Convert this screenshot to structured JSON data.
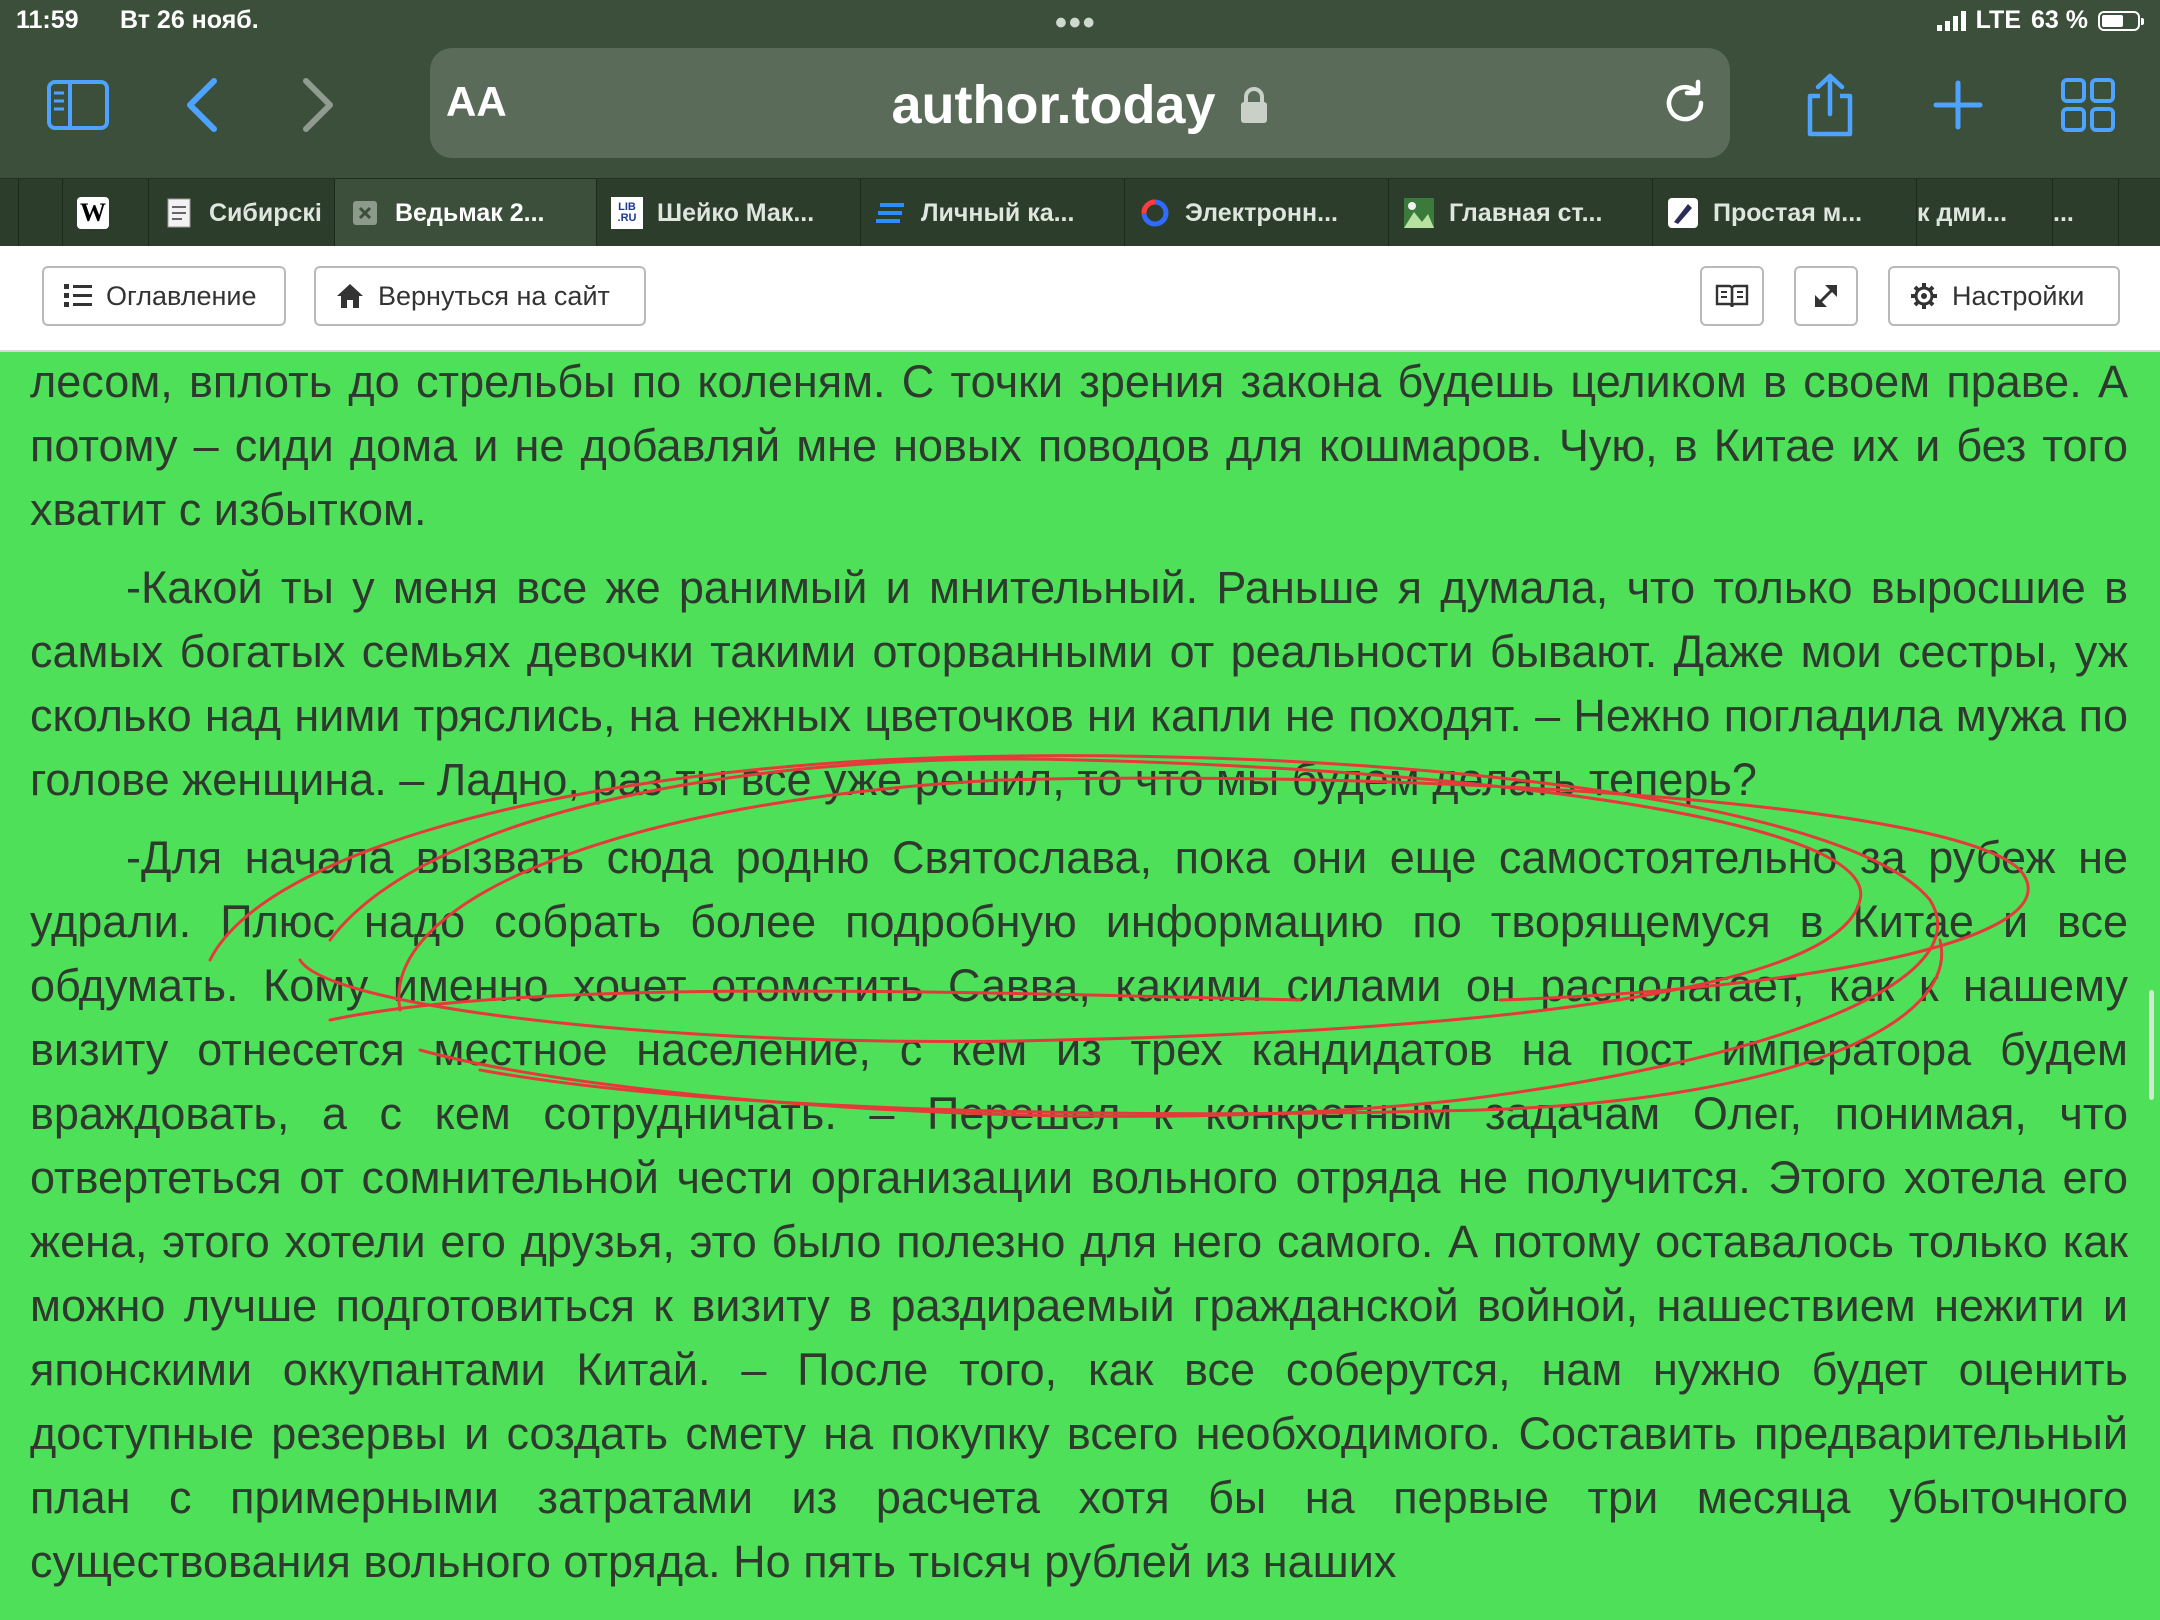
{
  "status": {
    "time": "11:59",
    "date": "Вт 26 нояб.",
    "network": "LTE",
    "battery": "63 %",
    "battery_level": 0.63
  },
  "address_bar": {
    "text_size_label": "AA",
    "domain": "author.today"
  },
  "tabs": [
    {
      "label": "",
      "icon": "wikipedia-icon"
    },
    {
      "label": "Сибирскі",
      "icon": "document-icon"
    },
    {
      "label": "Ведьмак 2...",
      "icon": "close-icon",
      "active": true
    },
    {
      "label": "Шейко Мак...",
      "icon": "lib-ru-icon"
    },
    {
      "label": "Личный ка...",
      "icon": "lines-icon"
    },
    {
      "label": "Электронн...",
      "icon": "service-icon"
    },
    {
      "label": "Главная ст...",
      "icon": "image-icon"
    },
    {
      "label": "Простая м...",
      "icon": "pen-icon"
    },
    {
      "label": "к дми...",
      "icon": ""
    },
    {
      "label": "...",
      "icon": ""
    }
  ],
  "reader_bar": {
    "toc_label": "Оглавление",
    "back_label": "Вернуться на сайт",
    "settings_label": "Настройки"
  },
  "content": {
    "paragraphs": [
      "лесом, вплоть до стрельбы по коленям. С точки зрения закона будешь целиком в своем праве. А потому – сиди дома и не добавляй мне новых поводов для кошмаров. Чую, в Китае их и без того хватит с избытком.",
      "-Какой ты у меня все же ранимый и мнительный. Раньше я думала, что только выросшие в самых богатых семьях девочки такими оторванными от реальности бывают. Даже мои сестры, уж сколько над ними тряслись, на нежных цветочков ни капли не походят. – Нежно погладила мужа по голове женщина. – Ладно, раз ты все уже решил, то что мы будем делать теперь?",
      "-Для начала вызвать сюда родню Святослава, пока они еще самостоятельно за рубеж не удрали. Плюс надо собрать более подробную информацию по творящемуся в Китае и все обдумать. Кому именно хочет отомстить Савва, какими силами он располагает, как к нашему визиту отнесется местное население, с кем из трех кандидатов на пост императора будем враждовать, а с кем сотрудничать. – Перешел к конкретным задачам Олег, понимая, что отвертеться от сомнительной чести организации вольного отряда не получится. Этого хотела его жена, этого хотели его друзья, это было полезно для него самого. А потому оставалось только как можно лучше подготовиться к визиту в раздираемый гражданской войной, нашествием нежити и японскими оккупантами Китай. – После того, как все соберутся, нам нужно будет оценить доступные резервы и создать смету на покупку всего необходимого. Составить предварительный план с примерными затратами из расчета хотя бы на первые три месяца убыточного существования вольного отряда. Но пять тысяч рублей из наших"
    ]
  },
  "colors": {
    "chrome": "#3c4f3b",
    "reader_background": "#4fe05a",
    "text": "#2e3a2e",
    "accent_blue": "#4da3ff",
    "scribble": "#e53a3a"
  }
}
